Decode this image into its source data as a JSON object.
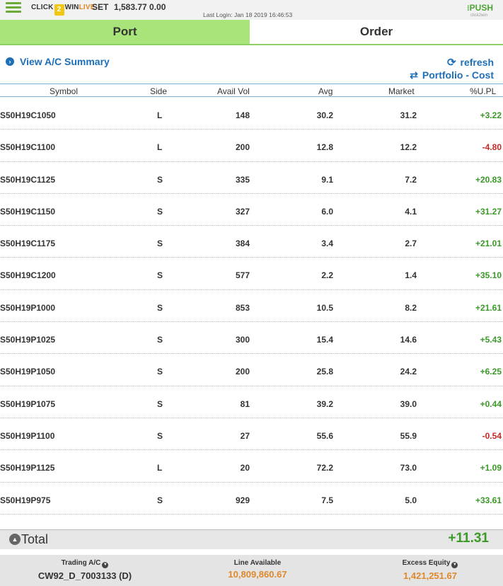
{
  "header": {
    "brand_click": "CLICK",
    "brand_two": "2",
    "brand_win": "WIN",
    "brand_live": "LIVE",
    "index_name": "SET",
    "index_value": "1,583.77 0.00",
    "last_login": "Last Login: Jan 18 2019 16:46:53",
    "push_dots": "⁝",
    "push_label": "PUSH",
    "push_sub": "click2win",
    "colors": {
      "accent_green": "#a8e47a",
      "link_blue": "#1d6fb8",
      "gain": "#3a9a27",
      "loss": "#c62828",
      "highlight_orange": "#e0882a"
    }
  },
  "tabs": [
    {
      "label": "Port",
      "active": true
    },
    {
      "label": "Order",
      "active": false
    }
  ],
  "actions": {
    "view_ac_summary": "View A/C Summary",
    "refresh": "refresh",
    "portfolio_cost": "Portfolio - Cost"
  },
  "table": {
    "headers": {
      "symbol": "Symbol",
      "side": "Side",
      "avail_vol": "Avail Vol",
      "avg": "Avg",
      "market": "Market",
      "upl": "%U.PL"
    },
    "rows": [
      {
        "symbol": "S50H19C1050",
        "side": "L",
        "avail_vol": "148",
        "avg": "30.2",
        "market": "31.2",
        "upl": "+3.22",
        "trend": "pos"
      },
      {
        "symbol": "S50H19C1100",
        "side": "L",
        "avail_vol": "200",
        "avg": "12.8",
        "market": "12.2",
        "upl": "-4.80",
        "trend": "neg"
      },
      {
        "symbol": "S50H19C1125",
        "side": "S",
        "avail_vol": "335",
        "avg": "9.1",
        "market": "7.2",
        "upl": "+20.83",
        "trend": "pos"
      },
      {
        "symbol": "S50H19C1150",
        "side": "S",
        "avail_vol": "327",
        "avg": "6.0",
        "market": "4.1",
        "upl": "+31.27",
        "trend": "pos"
      },
      {
        "symbol": "S50H19C1175",
        "side": "S",
        "avail_vol": "384",
        "avg": "3.4",
        "market": "2.7",
        "upl": "+21.01",
        "trend": "pos"
      },
      {
        "symbol": "S50H19C1200",
        "side": "S",
        "avail_vol": "577",
        "avg": "2.2",
        "market": "1.4",
        "upl": "+35.10",
        "trend": "pos"
      },
      {
        "symbol": "S50H19P1000",
        "side": "S",
        "avail_vol": "853",
        "avg": "10.5",
        "market": "8.2",
        "upl": "+21.61",
        "trend": "pos"
      },
      {
        "symbol": "S50H19P1025",
        "side": "S",
        "avail_vol": "300",
        "avg": "15.4",
        "market": "14.6",
        "upl": "+5.43",
        "trend": "pos"
      },
      {
        "symbol": "S50H19P1050",
        "side": "S",
        "avail_vol": "200",
        "avg": "25.8",
        "market": "24.2",
        "upl": "+6.25",
        "trend": "pos"
      },
      {
        "symbol": "S50H19P1075",
        "side": "S",
        "avail_vol": "81",
        "avg": "39.2",
        "market": "39.0",
        "upl": "+0.44",
        "trend": "pos"
      },
      {
        "symbol": "S50H19P1100",
        "side": "S",
        "avail_vol": "27",
        "avg": "55.6",
        "market": "55.9",
        "upl": "-0.54",
        "trend": "neg"
      },
      {
        "symbol": "S50H19P1125",
        "side": "L",
        "avail_vol": "20",
        "avg": "72.2",
        "market": "73.0",
        "upl": "+1.09",
        "trend": "pos"
      },
      {
        "symbol": "S50H19P975",
        "side": "S",
        "avail_vol": "929",
        "avg": "7.5",
        "market": "5.0",
        "upl": "+33.61",
        "trend": "pos"
      }
    ]
  },
  "total": {
    "label": "Total",
    "value": "+11.31"
  },
  "footer": {
    "trading_ac_label": "Trading A/C",
    "trading_ac_value": "CW92_D_7003133 (D)",
    "line_available_label": "Line Available",
    "line_available_value": "10,809,860.67",
    "excess_equity_label": "Excess Equity",
    "excess_equity_value": "1,421,251.67"
  }
}
